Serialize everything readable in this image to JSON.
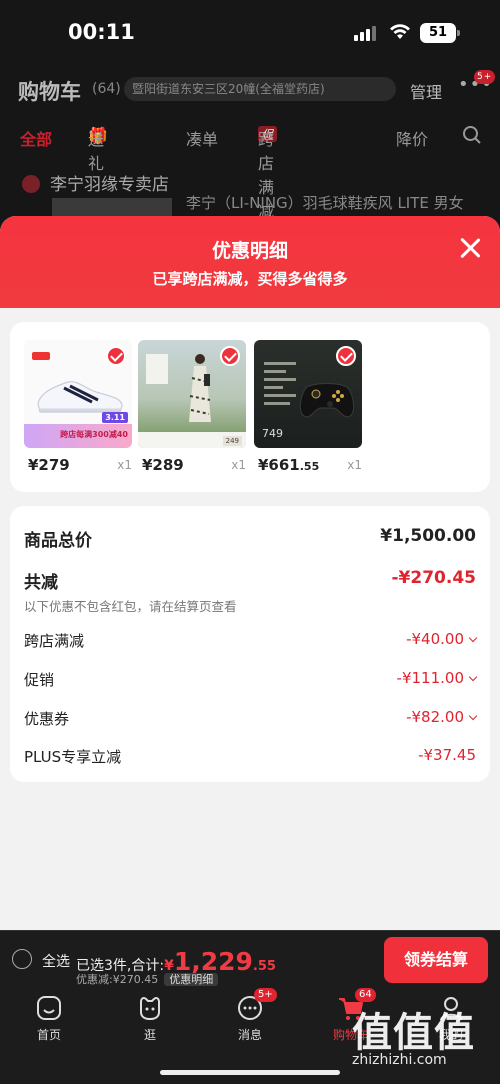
{
  "status": {
    "time": "00:11",
    "battery": "51"
  },
  "cart": {
    "title": "购物车",
    "count": "(64)",
    "address": "暨阳街道东安三区20幢(全福堂药店)",
    "manage": "管理",
    "more_badge": "5+",
    "filters": [
      "全部",
      "送礼",
      "凑单",
      "跨店满减",
      "降价"
    ],
    "filter_tag": "促",
    "shop": "李宁羽缘专卖店",
    "product_title": "李宁（LI-NING）羽毛球鞋疾风 LITE 男女"
  },
  "sheet": {
    "title": "优惠明细",
    "subtitle": "已享跨店满减，买得多省得多",
    "items": [
      {
        "price": "¥279",
        "qty": "x1",
        "promo": "跨店每满300减40",
        "day": "3.11"
      },
      {
        "price": "¥289",
        "qty": "x1",
        "tag": "249"
      },
      {
        "price_main": "¥661",
        "price_dec": ".55",
        "qty": "x1",
        "img_num": "749"
      }
    ],
    "summary": {
      "total_label": "商品总价",
      "total_value": "¥1,500.00",
      "reduce_label": "共减",
      "reduce_value": "-¥270.45",
      "note": "以下优惠不包含红包，请在结算页查看",
      "rows": [
        {
          "label": "跨店满减",
          "value": "-¥40.00"
        },
        {
          "label": "促销",
          "value": "-¥111.00"
        },
        {
          "label": "优惠券",
          "value": "-¥82.00"
        },
        {
          "label": "PLUS专享立减",
          "value": "-¥37.45"
        }
      ]
    }
  },
  "checkout": {
    "select_all": "全选",
    "selected": "已选3件,合计:",
    "currency": "¥",
    "total_int": "1,229",
    "total_dec": ".55",
    "saved": "优惠减:¥270.45",
    "detail_link": "优惠明细",
    "pay": "领券结算"
  },
  "tabs": [
    {
      "label": "首页"
    },
    {
      "label": "逛"
    },
    {
      "label": "消息",
      "badge": "5+"
    },
    {
      "label": "购物车",
      "badge": "64"
    },
    {
      "label": "我的"
    }
  ],
  "watermark": {
    "main": "值值值",
    "site": "zhizhizhi.com"
  },
  "colors": {
    "accent": "#f0313c",
    "discount": "#e0242f"
  }
}
